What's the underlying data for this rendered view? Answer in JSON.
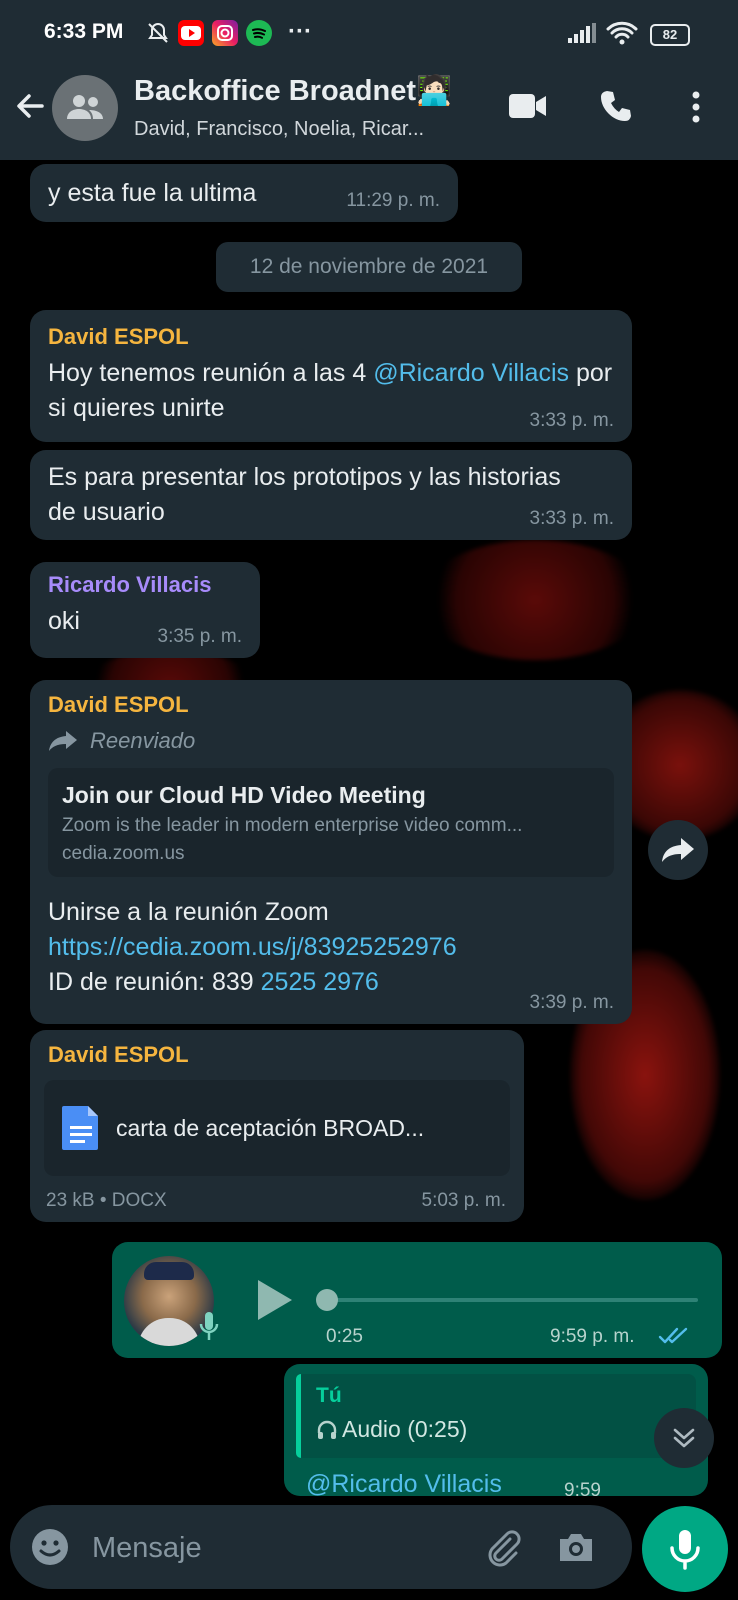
{
  "status_bar": {
    "time": "6:33 PM",
    "more": "···",
    "battery": "82"
  },
  "header": {
    "title": "Backoffice Broadnet🧑🏻‍💻",
    "subtitle": "David, Francisco, Noelia, Ricar..."
  },
  "messages": {
    "m1": {
      "text": "y esta fue la ultima",
      "time": "11:29 p. m."
    },
    "date_chip": "12 de noviembre de 2021",
    "m2": {
      "sender": "David ESPOL",
      "text_before": "Hoy tenemos reunión a las 4 ",
      "mention": "@Ricardo Villacis",
      "text_after": " por si quieres unirte",
      "time": "3:33 p. m."
    },
    "m3": {
      "text": "Es para presentar los prototipos y las historias de usuario",
      "time": "3:33 p. m."
    },
    "m4": {
      "sender": "Ricardo Villacis",
      "text": "oki",
      "time": "3:35 p. m."
    },
    "m5": {
      "sender": "David ESPOL",
      "forwarded_label": "Reenviado",
      "preview_title": "Join our Cloud HD Video Meeting",
      "preview_desc": "Zoom is the leader in modern enterprise video comm...",
      "preview_domain": "cedia.zoom.us",
      "line1": "Unirse a la reunión Zoom",
      "url": "https://cedia.zoom.us/j/83925252976",
      "id_label": "ID de reunión: 839 ",
      "id_link": "2525 2976",
      "time": "3:39 p. m."
    },
    "m6": {
      "sender": "David ESPOL",
      "file_name": "carta de aceptación BROAD...",
      "file_meta": "23 kB • DOCX",
      "time": "5:03 p. m."
    },
    "m7": {
      "duration": "0:25",
      "time": "9:59 p. m.",
      "progress": 0
    },
    "m8": {
      "quote_author": "Tú",
      "quote_text": "Audio (0:25)",
      "mention": "@Ricardo Villacis",
      "time": "9:59"
    }
  },
  "input": {
    "placeholder": "Mensaje"
  },
  "colors": {
    "header_bg": "#1f2c34",
    "bubble_in": "#1f2c34",
    "bubble_out": "#005c4b",
    "accent": "#00a884",
    "sender_david": "#f5b53f",
    "sender_ricardo": "#a78bfa",
    "link": "#53bdeb"
  }
}
